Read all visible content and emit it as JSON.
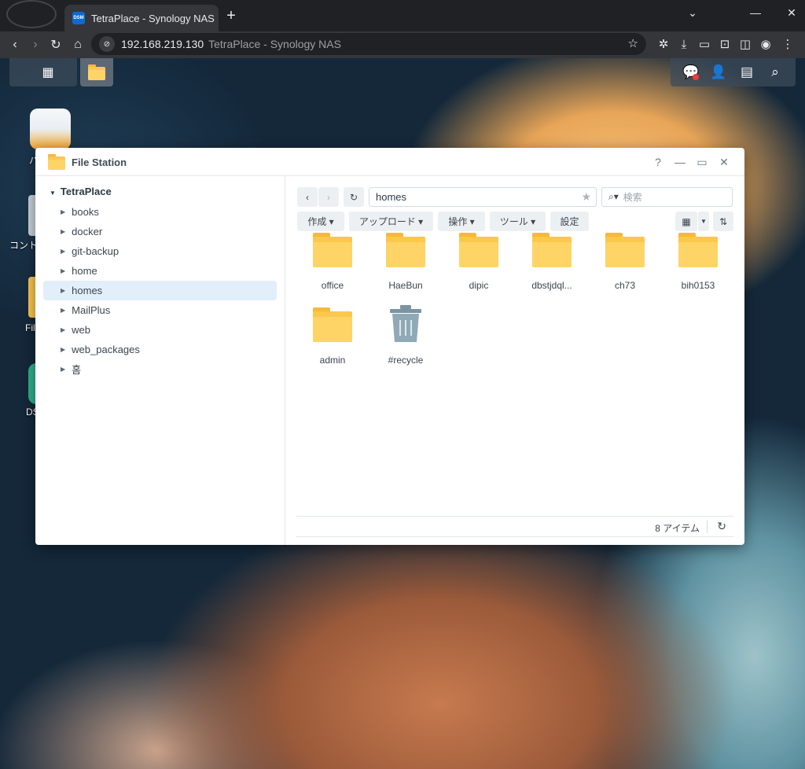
{
  "browser": {
    "tab_title": "TetraPlace - Synology NAS",
    "tab_favicon_text": "DSM",
    "new_tab": "+",
    "url_host": "192.168.219.130",
    "url_title": "TetraPlace - Synology NAS",
    "window_controls": {
      "collapse": "⌄",
      "minimize": "—",
      "maximize": "☐",
      "close": "✕"
    }
  },
  "desktop": {
    "icon_labels": [
      "パ",
      "コント",
      "Fil",
      "DS"
    ]
  },
  "window": {
    "title": "File Station",
    "controls": {
      "help": "?",
      "minimize": "—",
      "maximize": "▭",
      "close": "✕"
    }
  },
  "tree": {
    "root": "TetraPlace",
    "items": [
      {
        "label": "books"
      },
      {
        "label": "docker"
      },
      {
        "label": "git-backup"
      },
      {
        "label": "home"
      },
      {
        "label": "homes",
        "selected": true
      },
      {
        "label": "MailPlus"
      },
      {
        "label": "web"
      },
      {
        "label": "web_packages"
      },
      {
        "label": "홈"
      }
    ]
  },
  "toolbar": {
    "path": "homes",
    "search_placeholder": "検索",
    "create": "作成 ▾",
    "upload": "アップロード ▾",
    "action": "操作 ▾",
    "tools": "ツール ▾",
    "settings": "設定"
  },
  "files": [
    {
      "name": "office",
      "type": "folder"
    },
    {
      "name": "HaeBun",
      "type": "folder"
    },
    {
      "name": "dipic",
      "type": "folder"
    },
    {
      "name": "dbstjdql...",
      "type": "folder"
    },
    {
      "name": "ch73",
      "type": "folder"
    },
    {
      "name": "bih0153",
      "type": "folder"
    },
    {
      "name": "admin",
      "type": "folder"
    },
    {
      "name": "#recycle",
      "type": "recycle-bin"
    }
  ],
  "status": {
    "item_count": "8 アイテム"
  },
  "colors": {
    "accent": "#0a6bd4",
    "folder": "#fcc74d",
    "selected_row": "#e2eefa"
  }
}
